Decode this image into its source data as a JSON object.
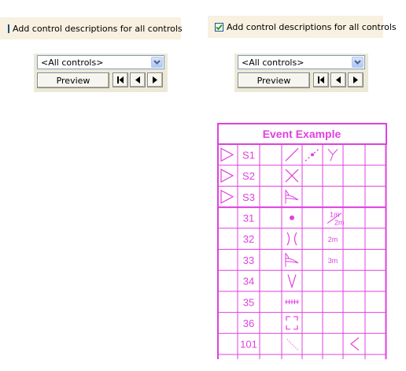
{
  "left": {
    "checkbox_label": "Add control descriptions for all controls",
    "checked": false,
    "select_value": "<All controls>",
    "preview_label": "Preview"
  },
  "right": {
    "checkbox_label": "Add control descriptions for all controls",
    "checked": true,
    "select_value": "<All controls>",
    "preview_label": "Preview"
  },
  "report": {
    "title": "Event Example",
    "rows": [
      {
        "id": "S1",
        "start_marker": true
      },
      {
        "id": "S2",
        "start_marker": true
      },
      {
        "id": "S3",
        "start_marker": true
      },
      {
        "id": "31",
        "start_marker": false,
        "note_top": "1m",
        "note_bottom": "2m"
      },
      {
        "id": "32",
        "start_marker": false,
        "note": "2m"
      },
      {
        "id": "33",
        "start_marker": false,
        "note": "3m"
      },
      {
        "id": "34",
        "start_marker": false
      },
      {
        "id": "35",
        "start_marker": false
      },
      {
        "id": "36",
        "start_marker": false
      },
      {
        "id": "101",
        "start_marker": false
      }
    ],
    "line_color": "#e040e0"
  },
  "icons": {
    "first": "first-record-icon",
    "prev": "previous-record-icon",
    "next": "next-record-icon",
    "dropdown": "chevron-down-icon",
    "check": "check-icon"
  }
}
